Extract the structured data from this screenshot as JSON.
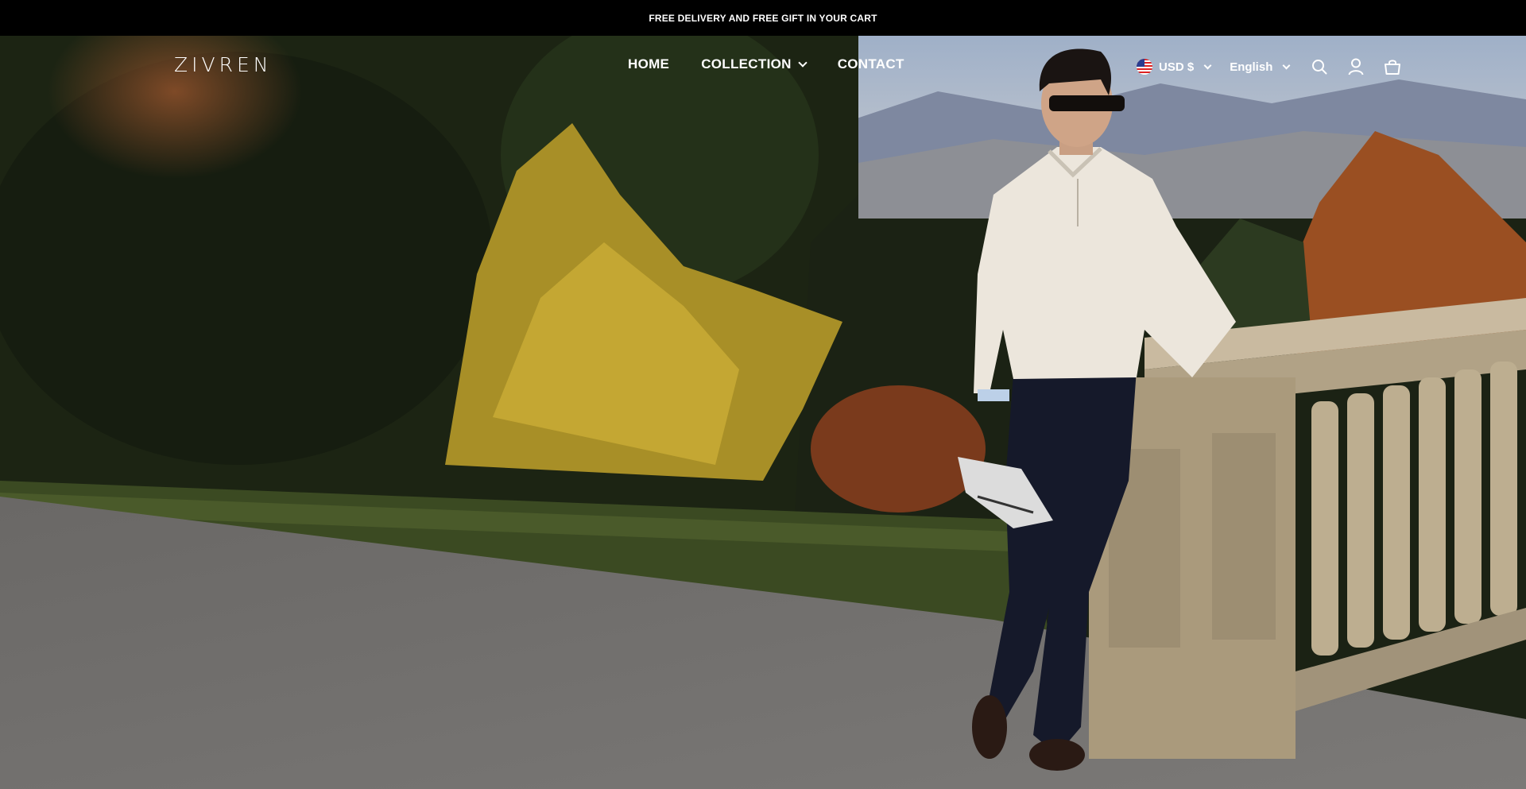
{
  "announcement": {
    "text": "FREE DELIVERY AND FREE GIFT IN YOUR CART"
  },
  "header": {
    "logo": "ZIVREN",
    "nav": [
      {
        "label": "HOME",
        "has_dropdown": false
      },
      {
        "label": "COLLECTION",
        "has_dropdown": true
      },
      {
        "label": "CONTACT",
        "has_dropdown": false
      }
    ],
    "currency": {
      "label": "USD $",
      "flag": "us-flag-icon"
    },
    "language": {
      "label": "English"
    },
    "icons": [
      "search-icon",
      "account-icon",
      "cart-icon"
    ]
  },
  "hero": {
    "image": "man-in-cream-quarter-zip-leaning-on-stone-balustrade",
    "colors": {
      "foliage_dark": "#1e2515",
      "foliage_yellow": "#b59a2a",
      "road": "#6f6e6c",
      "sweater": "#ece6dc",
      "trousers": "#15192a",
      "stone": "#b1a286"
    }
  }
}
